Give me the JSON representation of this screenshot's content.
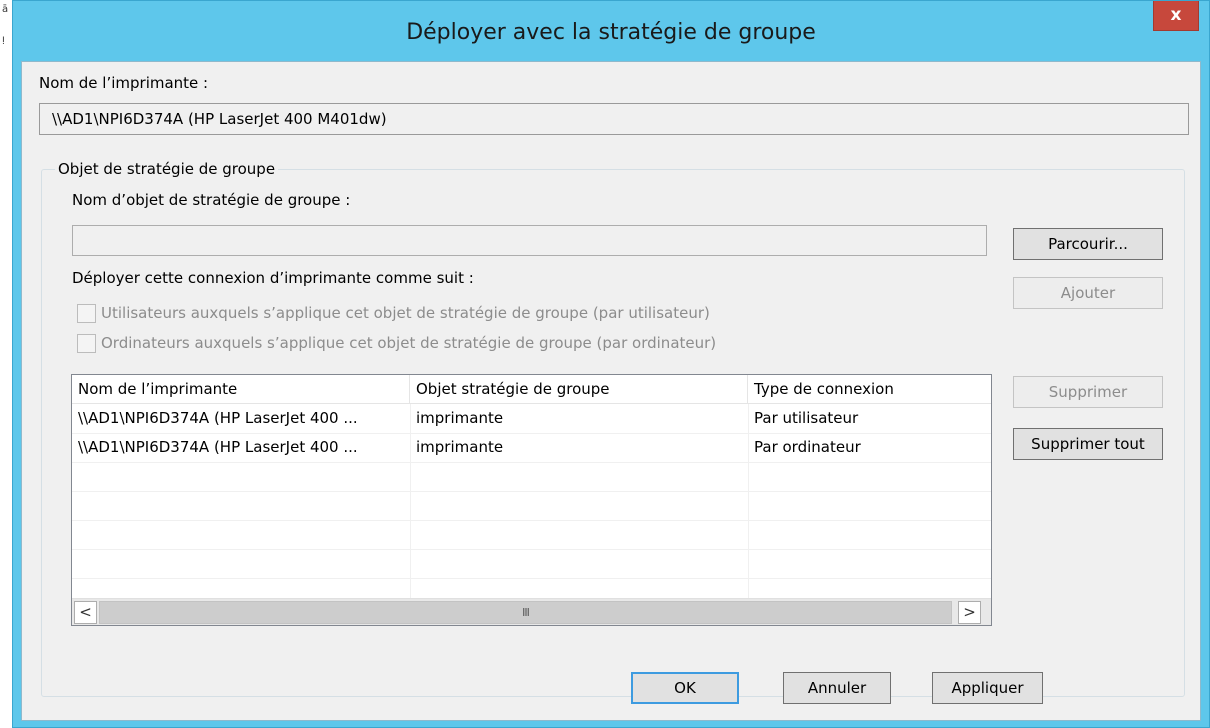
{
  "window": {
    "title": "Déployer avec la stratégie de groupe",
    "close_label": "x",
    "accent_color": "#5ec7eb",
    "close_color": "#c7483c"
  },
  "printer_name": {
    "label": "Nom de l’imprimante :",
    "value": "\\\\AD1\\NPI6D374A (HP LaserJet 400 M401dw)"
  },
  "gpo": {
    "group_title": "Objet de stratégie de groupe",
    "name_label": "Nom d’objet de stratégie de groupe :",
    "name_value": "",
    "browse_label": "Parcourir...",
    "deploy_label": "Déployer cette connexion d’imprimante comme suit :",
    "add_label": "Ajouter",
    "checkbox_user": {
      "label": "Utilisateurs auxquels s’applique cet objet de stratégie de groupe (par utilisateur)",
      "checked": false
    },
    "checkbox_computer": {
      "label": "Ordinateurs auxquels s’applique cet objet de stratégie de groupe (par ordinateur)",
      "checked": false
    }
  },
  "list": {
    "columns": [
      "Nom de l’imprimante",
      "Objet stratégie de groupe",
      "Type de connexion"
    ],
    "rows": [
      [
        "\\\\AD1\\NPI6D374A (HP LaserJet 400 ...",
        "imprimante",
        "Par utilisateur"
      ],
      [
        "\\\\AD1\\NPI6D374A (HP LaserJet 400 ...",
        "imprimante",
        "Par ordinateur"
      ]
    ],
    "scroll_left": "<",
    "scroll_right": ">",
    "scroll_thumb": "III"
  },
  "side_buttons": {
    "remove_label": "Supprimer",
    "remove_all_label": "Supprimer tout"
  },
  "footer": {
    "ok_label": "OK",
    "cancel_label": "Annuler",
    "apply_label": "Appliquer"
  }
}
